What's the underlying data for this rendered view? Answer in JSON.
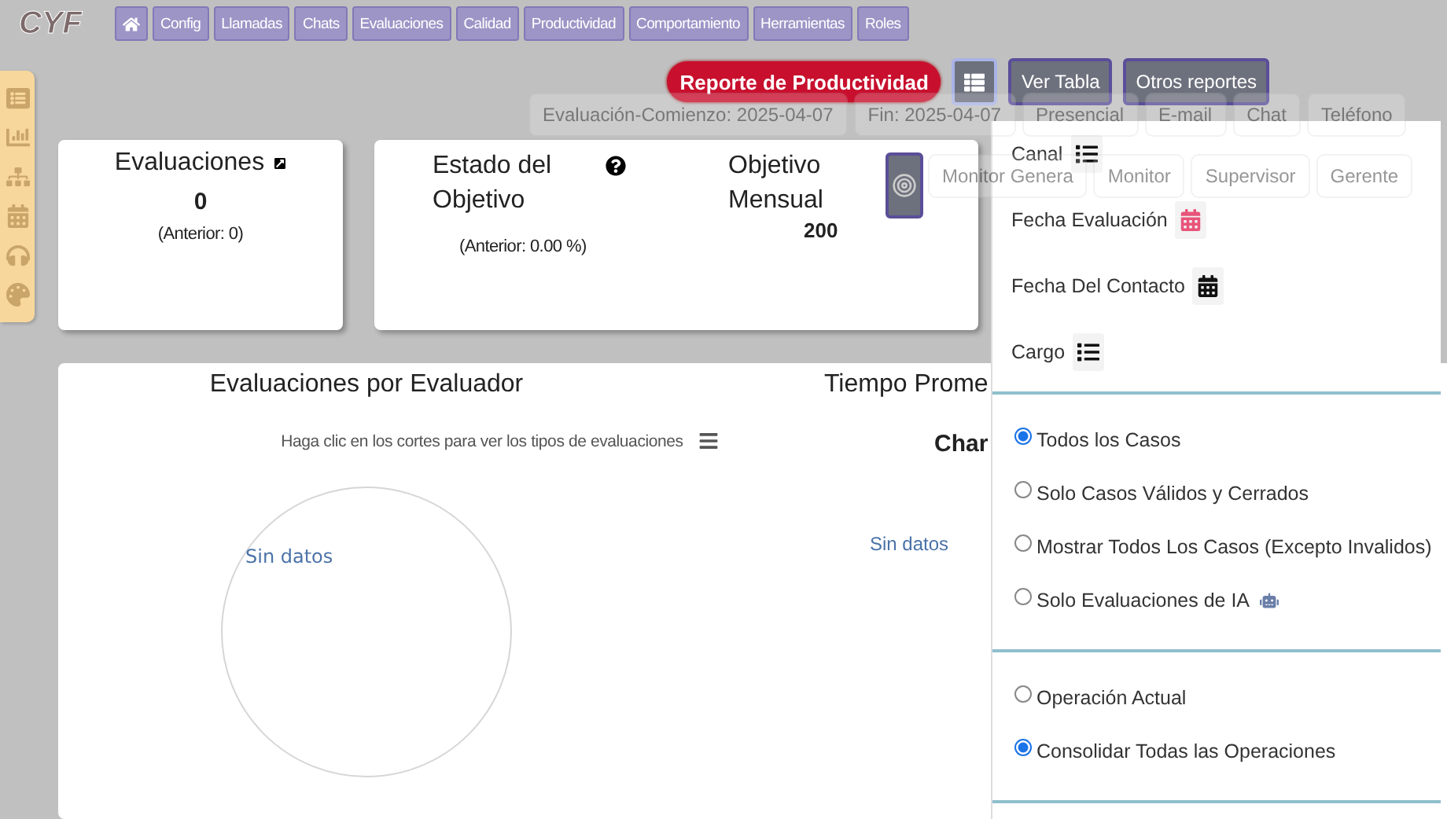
{
  "logo": "CYF",
  "nav": {
    "items": [
      "Config",
      "Llamadas",
      "Chats",
      "Evaluaciones",
      "Calidad",
      "Productividad",
      "Comportamiento",
      "Herramientas",
      "Roles"
    ]
  },
  "toolbar": {
    "report_title": "Reporte de Productividad",
    "buttons": [
      "Ver Tabla",
      "Otros reportes"
    ]
  },
  "filter_chips": [
    [
      "Evaluación-Comienzo: 2025-04-07",
      "Fin: 2025-04-07",
      "Presencial",
      "E-mail",
      "Chat",
      "Teléfono"
    ],
    [
      "Monitor Genera",
      "Monitor",
      "Supervisor",
      "Gerente"
    ]
  ],
  "evaluations_card": {
    "title": "Evaluaciones",
    "value": "0",
    "previous": "(Anterior: 0)"
  },
  "goal_card": {
    "title": "Estado del Objetivo",
    "previous": "(Anterior: 0.00 %)",
    "target_title": "Objetivo Mensual",
    "target_value": "200"
  },
  "charts": [
    {
      "title": "Evaluaciones por Evaluador",
      "subtitle": "Haga clic en los cortes para ver los tipos de evaluaciones",
      "empty": "Sin datos"
    },
    {
      "title": "Tiempo Prome",
      "heading": "Char",
      "empty": "Sin datos"
    }
  ],
  "dropdown": {
    "group_by": [
      {
        "label": "Canal",
        "kind": "list",
        "highlighted": false
      },
      {
        "label": "Fecha Evaluación",
        "kind": "calendar",
        "highlighted": true
      },
      {
        "label": "Fecha Del Contacto",
        "kind": "calendar",
        "highlighted": false
      },
      {
        "label": "Cargo",
        "kind": "list",
        "highlighted": false
      }
    ],
    "case_filter": [
      {
        "label": "Todos los Casos",
        "selected": true,
        "ai": false
      },
      {
        "label": "Solo Casos Válidos y Cerrados",
        "selected": false,
        "ai": false
      },
      {
        "label": "Mostrar Todos Los Casos (Excepto Invalidos)",
        "selected": false,
        "ai": false
      },
      {
        "label": "Solo Evaluaciones de IA",
        "selected": false,
        "ai": true
      }
    ],
    "operation": [
      {
        "label": "Operación Actual",
        "selected": false
      },
      {
        "label": "Consolidar Todas las Operaciones",
        "selected": true
      }
    ]
  }
}
